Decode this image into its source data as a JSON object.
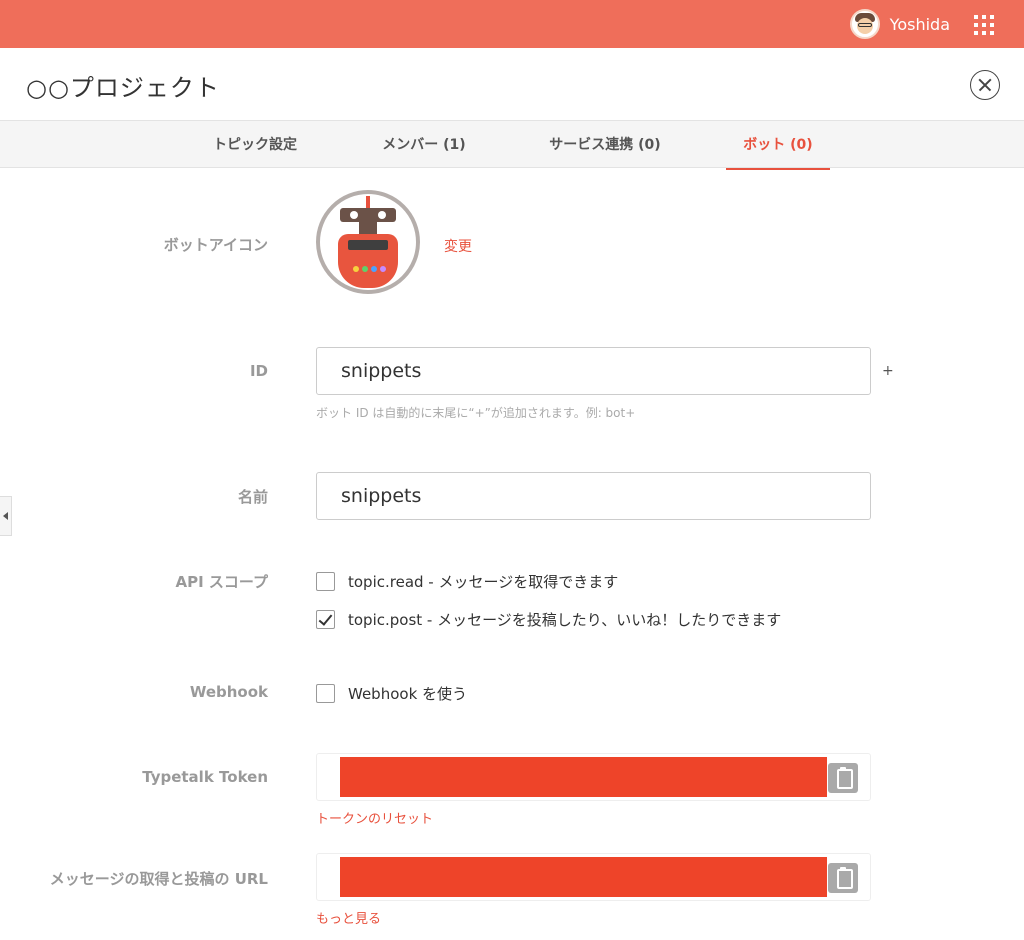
{
  "topbar": {
    "username": "Yoshida"
  },
  "header": {
    "title": "○○プロジェクト"
  },
  "tabs": [
    {
      "label": "トピック設定"
    },
    {
      "label": "メンバー (1)"
    },
    {
      "label": "サービス連携 (0)"
    },
    {
      "label": "ボット (0)"
    }
  ],
  "form": {
    "bot_icon": {
      "label": "ボットアイコン",
      "change_label": "変更"
    },
    "id": {
      "label": "ID",
      "value": "snippets",
      "suffix": "+",
      "hint": "ボット ID は自動的に末尾に“+”が追加されます。例: bot+"
    },
    "name": {
      "label": "名前",
      "value": "snippets"
    },
    "api_scope": {
      "label": "API スコープ",
      "options": [
        {
          "label": "topic.read - メッセージを取得できます",
          "checked": false
        },
        {
          "label": "topic.post - メッセージを投稿したり、いいね！したりできます",
          "checked": true
        }
      ]
    },
    "webhook": {
      "label": "Webhook",
      "option_label": "Webhook を使う",
      "checked": false
    },
    "token": {
      "label": "Typetalk Token",
      "reset_label": "トークンのリセット"
    },
    "url": {
      "label": "メッセージの取得と投稿の URL",
      "more_label": "もっと見る"
    }
  },
  "colors": {
    "accent": "#e8513d",
    "topbar": "#ef6e5a",
    "redaction": "#ee4429"
  }
}
